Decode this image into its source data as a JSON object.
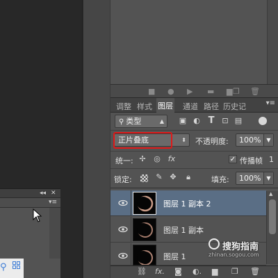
{
  "tabs": [
    {
      "label": "调整"
    },
    {
      "label": "样式"
    },
    {
      "label": "图层"
    },
    {
      "label": "通道"
    },
    {
      "label": "路径"
    },
    {
      "label": "历史记"
    }
  ],
  "filter": {
    "kind_label": "类型"
  },
  "blend": {
    "mode": "正片叠底",
    "opacity_label": "不透明度:",
    "opacity_value": "100%"
  },
  "unify": {
    "label": "统一:",
    "propagate_label": "传播帧",
    "propagate_num": "1"
  },
  "lock": {
    "label": "锁定:",
    "fill_label": "填充:",
    "fill_value": "100%"
  },
  "layers": [
    {
      "name": "图层 1 副本 2",
      "selected": true
    },
    {
      "name": "图层 1 副本",
      "selected": false
    },
    {
      "name": "图层 1",
      "selected": false
    }
  ],
  "footer_icons": [
    "link-icon",
    "fx-icon",
    "mask-icon",
    "adjustment-icon",
    "group-icon",
    "new-layer-icon",
    "trash-icon"
  ],
  "watermark": {
    "text": "搜狗指南",
    "sub": "zhinan.sogou.com"
  }
}
